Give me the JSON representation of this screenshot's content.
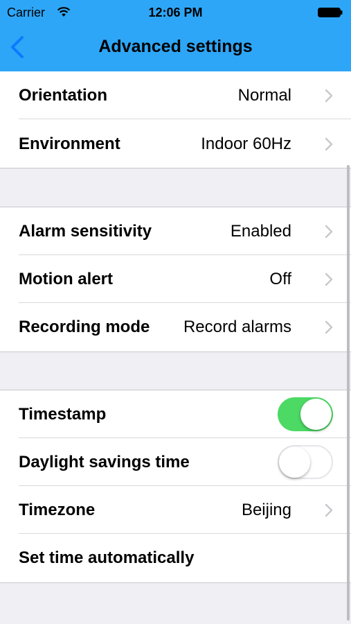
{
  "status_bar": {
    "carrier": "Carrier",
    "time": "12:06 PM"
  },
  "nav": {
    "title": "Advanced settings"
  },
  "sections": [
    {
      "rows": [
        {
          "label": "Orientation",
          "value": "Normal"
        },
        {
          "label": "Environment",
          "value": "Indoor 60Hz"
        }
      ]
    },
    {
      "rows": [
        {
          "label": "Alarm sensitivity",
          "value": "Enabled"
        },
        {
          "label": "Motion alert",
          "value": "Off"
        },
        {
          "label": "Recording mode",
          "value": "Record alarms"
        }
      ]
    },
    {
      "rows": [
        {
          "label": "Timestamp",
          "toggle": true
        },
        {
          "label": "Daylight savings time",
          "toggle": false
        },
        {
          "label": "Timezone",
          "value": "Beijing"
        },
        {
          "label": "Set time automatically"
        }
      ]
    }
  ],
  "colors": {
    "accent": "#2ea6f7",
    "toggle_on": "#4cd964",
    "background": "#efeff4",
    "back_icon": "#0a7bff"
  },
  "icons": {
    "back": "chevron-left-icon",
    "disclosure": "chevron-right-icon",
    "wifi": "wifi-icon",
    "battery": "battery-icon"
  }
}
